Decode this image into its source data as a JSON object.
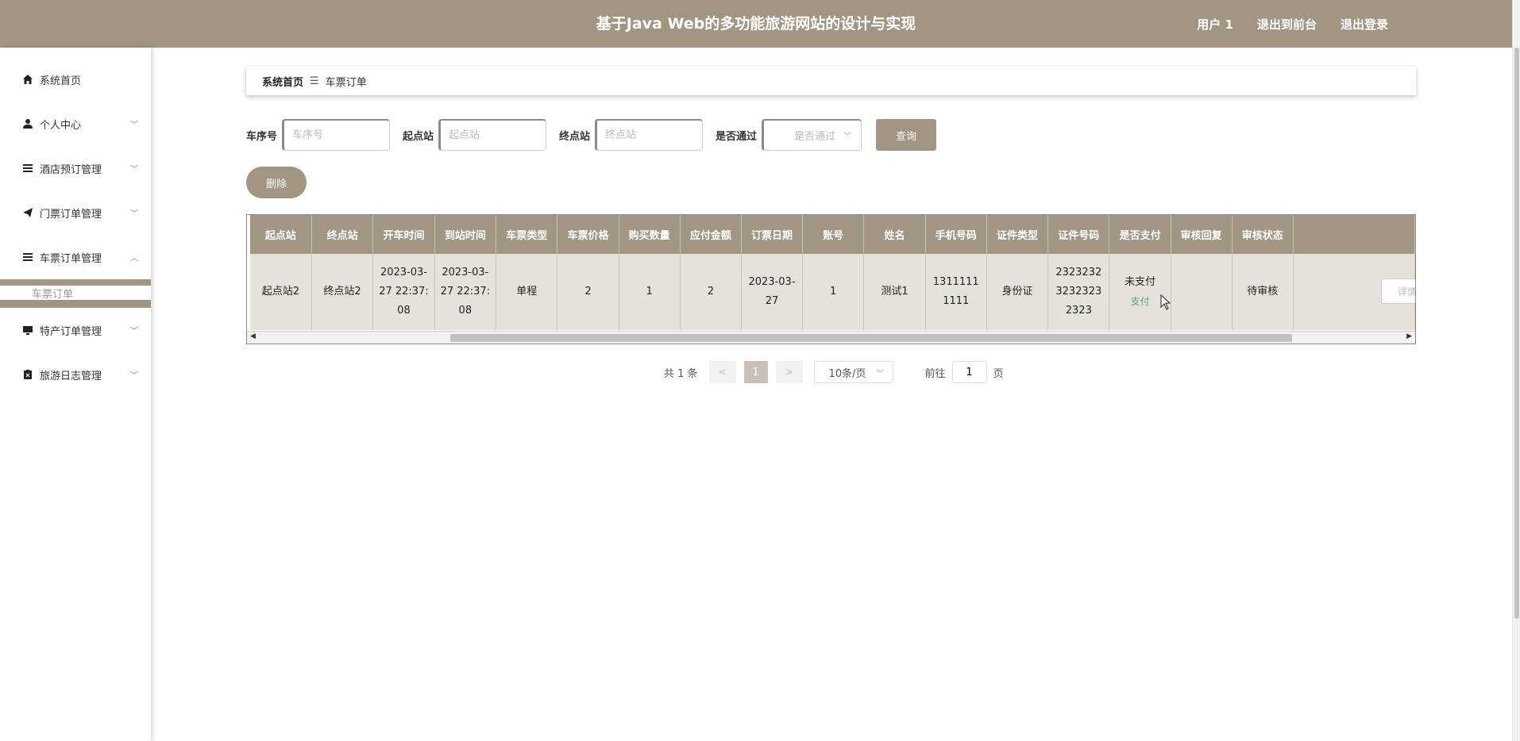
{
  "header": {
    "title": "基于Java Web的多功能旅游网站的设计与实现",
    "user": "用户 1",
    "back_frontend": "退出到前台",
    "logout": "退出登录"
  },
  "sidebar": {
    "items": [
      {
        "label": "系统首页",
        "icon": "home-icon"
      },
      {
        "label": "个人中心",
        "icon": "user-icon"
      },
      {
        "label": "酒店预订管理",
        "icon": "list-icon"
      },
      {
        "label": "门票订单管理",
        "icon": "send-icon"
      },
      {
        "label": "车票订单管理",
        "icon": "list-icon"
      },
      {
        "label": "特产订单管理",
        "icon": "monitor-icon"
      },
      {
        "label": "旅游日志管理",
        "icon": "clipboard-icon"
      }
    ],
    "submenu": "车票订单"
  },
  "breadcrumb": {
    "home": "系统首页",
    "current": "车票订单"
  },
  "search": {
    "car_no_label": "车序号",
    "car_no_placeholder": "车序号",
    "start_label": "起点站",
    "start_placeholder": "起点站",
    "end_label": "终点站",
    "end_placeholder": "终点站",
    "pass_label": "是否通过",
    "pass_placeholder": "是否通过",
    "query_button": "查询"
  },
  "actions": {
    "delete_button": "删除"
  },
  "table": {
    "headers": [
      "起点站",
      "终点站",
      "开车时间",
      "到站时间",
      "车票类型",
      "车票价格",
      "购买数量",
      "应付金额",
      "订票日期",
      "账号",
      "姓名",
      "手机号码",
      "证件类型",
      "证件号码",
      "是否支付",
      "审核回复",
      "审核状态"
    ],
    "row": {
      "start": "起点站2",
      "end": "终点站2",
      "depart_time": "2023-03-27 22:37:08",
      "arrive_time": "2023-03-27 22:37:08",
      "ticket_type": "单程",
      "price": "2",
      "quantity": "1",
      "amount": "2",
      "order_date": "2023-03-27",
      "account": "1",
      "name": "测试1",
      "phone": "13111111111",
      "id_type": "身份证",
      "id_number": "232323232323232323",
      "paid": "未支付",
      "pay_link": "支付",
      "reply": "",
      "status": "待审核",
      "detail_button": "详情"
    }
  },
  "pagination": {
    "total": "共 1 条",
    "prev": "<",
    "current": "1",
    "next": ">",
    "page_size": "10条/页",
    "goto_label": "前往",
    "goto_value": "1",
    "page_unit": "页"
  }
}
